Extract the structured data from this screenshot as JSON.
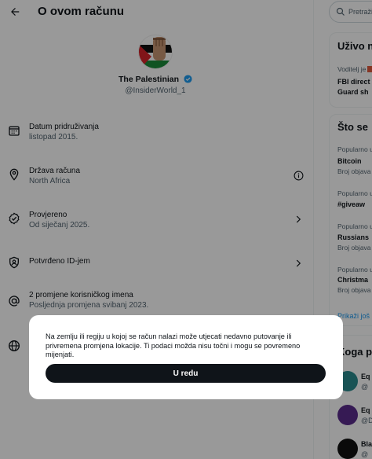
{
  "header": {
    "title": "O ovom računu"
  },
  "profile": {
    "display_name": "The Palestinian",
    "handle": "@InsiderWorld_1"
  },
  "info": [
    {
      "title": "Datum pridruživanja",
      "sub": "listopad 2015.",
      "icon": "calendar-icon",
      "right_icon": ""
    },
    {
      "title": "Država računa",
      "sub": "North Africa",
      "icon": "location-pin-icon",
      "right_icon": "info-icon"
    },
    {
      "title": "Provjereno",
      "sub": "Od siječanj 2025.",
      "icon": "verified-check-icon",
      "right_icon": "chevron-right-icon"
    },
    {
      "title": "Potvrđeno ID-jem",
      "sub": "",
      "icon": "id-badge-icon",
      "right_icon": "chevron-right-icon"
    },
    {
      "title": "2 promjene korisničkog imena",
      "sub": "Posljednja promjena svibanj 2023.",
      "icon": "at-sign-icon",
      "right_icon": ""
    },
    {
      "title": "",
      "sub": "",
      "icon": "globe-icon",
      "right_icon": ""
    }
  ],
  "search": {
    "placeholder": "Pretraži"
  },
  "live": {
    "title": "Uživo n",
    "host_line": "Voditelj je",
    "event_line1": "FBI direct",
    "event_line2": "Guard sh"
  },
  "trends": {
    "title": "Što se",
    "items": [
      {
        "context": "Popularno u",
        "name": "Bitcoin",
        "count": "Broj objava"
      },
      {
        "context": "Popularno u",
        "name": "#giveaw",
        "count": ""
      },
      {
        "context": "Popularno u",
        "name": "Russians",
        "count": "Broj objava"
      },
      {
        "context": "Popularno u",
        "name": "Christma",
        "count": "Broj objava"
      }
    ],
    "show_more": "Prikaži još"
  },
  "who_to_follow": {
    "title": "Koga p",
    "items": [
      {
        "name": "Eq",
        "handle": "@"
      },
      {
        "name": "Eq",
        "handle": "@D"
      },
      {
        "name": "Bla",
        "handle": "@"
      }
    ]
  },
  "modal": {
    "text": "Na zemlju ili regiju u kojoj se račun nalazi može utjecati nedavno putovanje ili privremena promjena lokacije. Ti podaci možda nisu točni i mogu se povremeno mijenjati.",
    "button": "U redu"
  },
  "colors": {
    "accent": "#1d9bf0",
    "text": "#0f1419",
    "secondary": "#536471",
    "overlay": "rgba(0,0,0,0.40)"
  }
}
